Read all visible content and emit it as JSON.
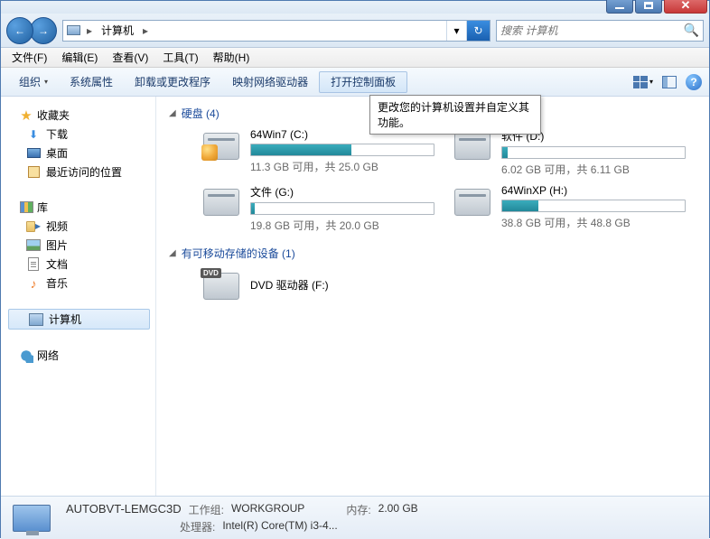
{
  "titlebar": {},
  "nav": {
    "breadcrumb_icon": "computer",
    "crumbs": [
      "计算机"
    ],
    "search_placeholder": "搜索 计算机"
  },
  "menubar": {
    "file": "文件(F)",
    "edit": "编辑(E)",
    "view": "查看(V)",
    "tools": "工具(T)",
    "help": "帮助(H)"
  },
  "toolbar": {
    "organize": "组织",
    "properties": "系统属性",
    "uninstall": "卸载或更改程序",
    "mapdrive": "映射网络驱动器",
    "controlpanel": "打开控制面板"
  },
  "tooltip": {
    "text": "更改您的计算机设置并自定义其功能。"
  },
  "sidebar": {
    "favorites": {
      "label": "收藏夹",
      "items": [
        {
          "label": "下载"
        },
        {
          "label": "桌面"
        },
        {
          "label": "最近访问的位置"
        }
      ]
    },
    "libraries": {
      "label": "库",
      "items": [
        {
          "label": "视频"
        },
        {
          "label": "图片"
        },
        {
          "label": "文档"
        },
        {
          "label": "音乐"
        }
      ]
    },
    "computer": {
      "label": "计算机"
    },
    "network": {
      "label": "网络"
    }
  },
  "content": {
    "hdd_section": "硬盘 (4)",
    "removable_section": "有可移动存储的设备 (1)",
    "drives": [
      {
        "name": "64Win7  (C:)",
        "fill_pct": 55,
        "stats": "11.3 GB 可用，共 25.0 GB"
      },
      {
        "name": "软件 (D:)",
        "fill_pct": 3,
        "stats": "6.02 GB 可用，共 6.11 GB"
      },
      {
        "name": "文件 (G:)",
        "fill_pct": 2,
        "stats": "19.8 GB 可用，共 20.0 GB"
      },
      {
        "name": "64WinXP  (H:)",
        "fill_pct": 20,
        "stats": "38.8 GB 可用，共 48.8 GB"
      }
    ],
    "dvd": {
      "name": "DVD 驱动器 (F:)"
    }
  },
  "statusbar": {
    "name": "AUTOBVT-LEMGC3D",
    "workgroup_label": "工作组:",
    "workgroup": "WORKGROUP",
    "memory_label": "内存:",
    "memory": "2.00 GB",
    "cpu_label": "处理器:",
    "cpu": "Intel(R) Core(TM) i3-4..."
  }
}
